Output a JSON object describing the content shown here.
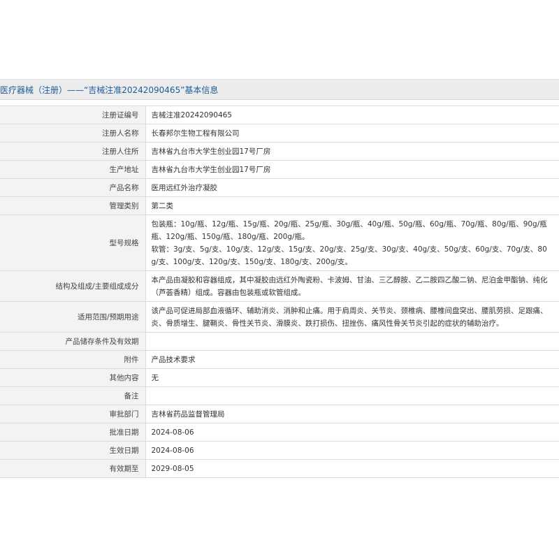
{
  "header": {
    "title": "医疗器械（注册）——“吉械注准20242090465”基本信息"
  },
  "rows": [
    {
      "label": "注册证编号",
      "value": "吉械注准20242090465"
    },
    {
      "label": "注册人名称",
      "value": "长春邦尔生物工程有限公司"
    },
    {
      "label": "注册人住所",
      "value": "吉林省九台市大学生创业园17号厂房"
    },
    {
      "label": "生产地址",
      "value": "吉林省九台市大学生创业园17号厂房"
    },
    {
      "label": "产品名称",
      "value": "医用远红外治疗凝胶"
    },
    {
      "label": "管理类别",
      "value": "第二类"
    },
    {
      "label": "型号规格",
      "lines": [
        "包装瓶：10g/瓶、12g/瓶、15g/瓶、20g/瓶、25g/瓶、30g/瓶、40g/瓶、50g/瓶、60g/瓶、70g/瓶、80g/瓶、90g/瓶",
        "瓶、120g/瓶、150g/瓶、180g/瓶、200g/瓶。",
        "软管：3g/支、5g/支、10g/支、12g/支、15g/支、20g/支、25g/支、30g/支、40g/支、50g/支、60g/支、70g/支、80",
        "g/支、100g/支、120g/支、150g/支、180g/支、200g/支。"
      ]
    },
    {
      "label": "结构及组成/主要组成成分",
      "lines": [
        "本产品由凝胶和容器组成，其中凝胶由远红外陶瓷粉、卡波姆、甘油、三乙醇胺、乙二胺四乙酸二钠、尼泊金甲酯钠、纯化",
        "（芦荟香精）组成。容器由包装瓶或软管组成。"
      ]
    },
    {
      "label": "适用范围/预期用途",
      "lines": [
        "该产品可促进局部血液循环、辅助消炎、消肿和止痛。用于肩周炎、关节炎、颈椎病、腰椎间盘突出、腰肌劳损、足跟痛、",
        "炎、骨质增生、腱鞘炎、骨性关节炎、滑膜炎、跌打损伤、扭挫伤、痛风性骨关节炎引起的症状的辅助治疗。"
      ]
    },
    {
      "label": "产品储存条件及有效期",
      "value": ""
    },
    {
      "label": "附件",
      "value": "产品技术要求"
    },
    {
      "label": "其他内容",
      "value": "无"
    },
    {
      "label": "备注",
      "value": ""
    },
    {
      "label": "审批部门",
      "value": "吉林省药品监督管理局"
    },
    {
      "label": "批准日期",
      "value": "2024-08-06"
    },
    {
      "label": "生效日期",
      "value": "2024-08-06"
    },
    {
      "label": "有效期至",
      "value": "2029-08-05"
    }
  ]
}
